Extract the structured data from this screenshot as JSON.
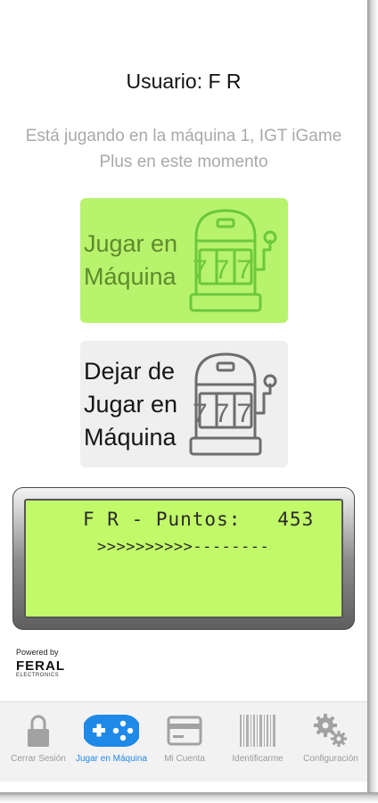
{
  "header": {
    "user_title": "Usuario: F R"
  },
  "status": {
    "message": "Está jugando en la máquina 1, IGT iGame Plus en este momento"
  },
  "actions": {
    "play": {
      "label_line1": "Jugar en",
      "label_line2": "Máquina",
      "reels": "777",
      "bg_color": "#b8f36e",
      "icon": "slot-machine-icon"
    },
    "stop": {
      "label_line1": "Dejar de",
      "label_line2": "Jugar en",
      "label_line3": "Máquina",
      "reels": "777",
      "bg_color": "#efefef",
      "icon": "slot-machine-icon"
    }
  },
  "lcd": {
    "line1": "F R - Puntos:   453",
    "line2": ">>>>>>>>>>--------",
    "points": 453,
    "screen_color": "#c2f969"
  },
  "powered": {
    "label": "Powered by",
    "brand": "FERAL",
    "sub": "ELECTRONICS"
  },
  "tabs": [
    {
      "label": "Cerrar Sesión",
      "icon": "lock-icon",
      "active": false
    },
    {
      "label": "Jugar en Máquina",
      "icon": "gamepad-icon",
      "active": true
    },
    {
      "label": "Mi Cuenta",
      "icon": "card-icon",
      "active": false
    },
    {
      "label": "Identificarme",
      "icon": "barcode-icon",
      "active": false
    },
    {
      "label": "Configuración",
      "icon": "gears-icon",
      "active": false
    }
  ],
  "colors": {
    "accent_active": "#1f89e8",
    "tab_inactive": "#9a9a9a"
  }
}
